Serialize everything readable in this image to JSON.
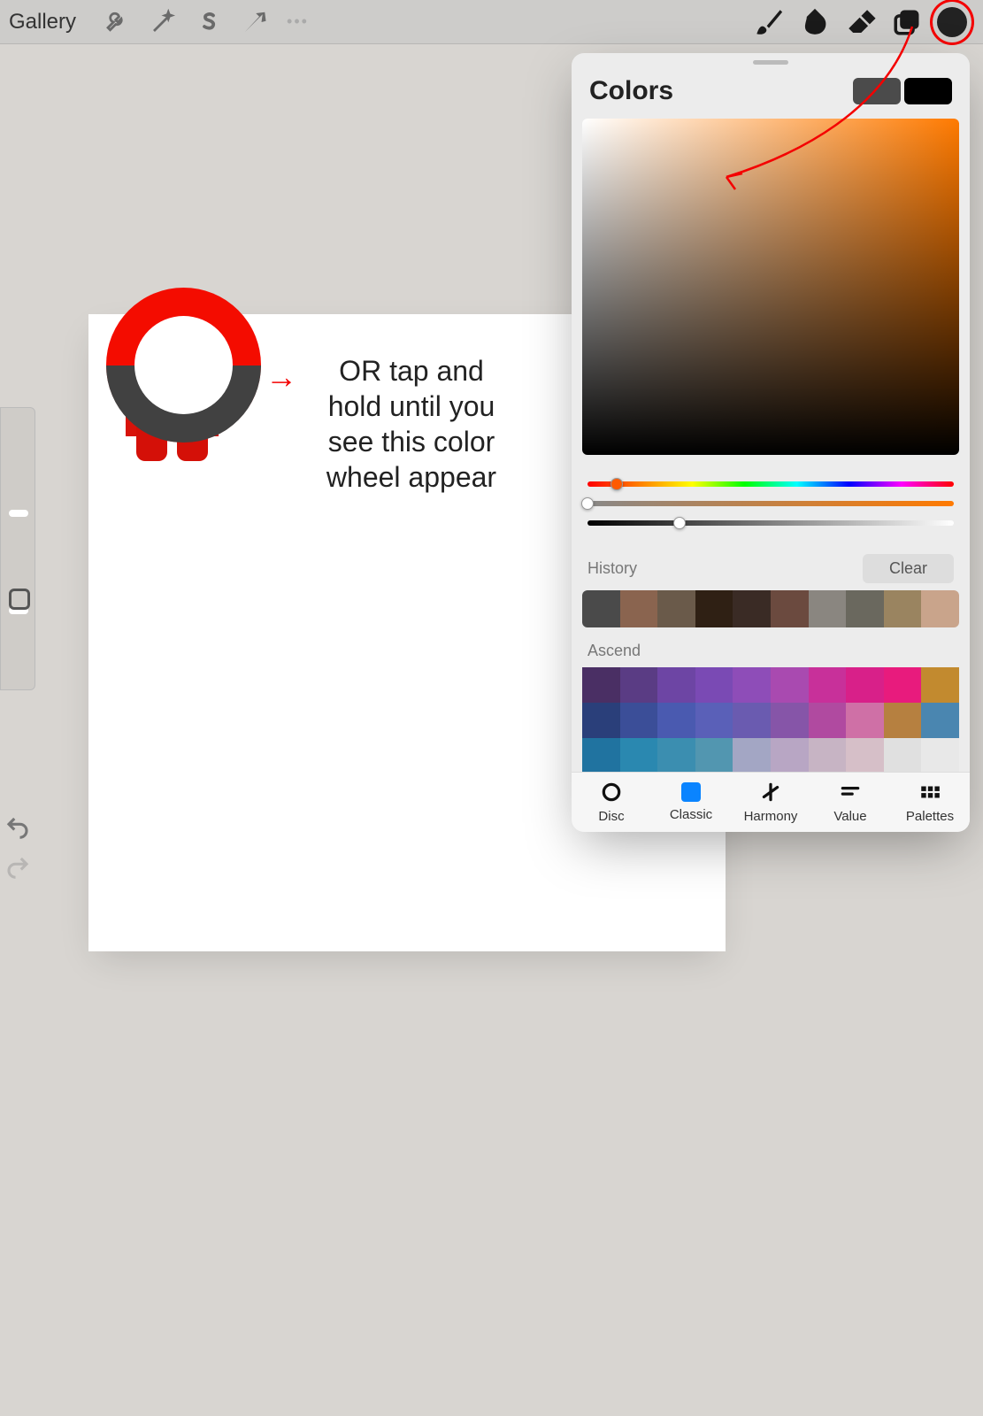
{
  "toolbar": {
    "gallery_label": "Gallery",
    "icons": {
      "wrench": "settings-wrench",
      "wand": "adjustments-wand",
      "selection": "selection-s",
      "transform": "transform-arrow",
      "brush": "brush",
      "smudge": "smudge",
      "erase": "eraser",
      "layers": "layers",
      "color": "#222222"
    }
  },
  "annotation": {
    "instructions": "OR tap and hold until you see this color wheel appear"
  },
  "colors_panel": {
    "title": "Colors",
    "prev_color": "#4b4b4b",
    "curr_color": "#000000",
    "hue_deg": 28,
    "hue_slider_pos": 0.08,
    "sat_slider_pos": 0.0,
    "val_slider_pos": 0.25,
    "history_label": "History",
    "clear_label": "Clear",
    "history": [
      "#4a4a4a",
      "#8a644f",
      "#6a5a4a",
      "#2f2014",
      "#3a2b25",
      "#6b4a3f",
      "#8a8680",
      "#6a685e",
      "#9a8460",
      "#c9a48b"
    ],
    "palette_label": "Ascend",
    "palette_rows": [
      [
        "#4a2f64",
        "#5a3c84",
        "#6d45a4",
        "#7a4ab4",
        "#8e4db8",
        "#a94ab0",
        "#c8309a",
        "#d82089",
        "#e81b7d",
        "#c28a2f"
      ],
      [
        "#2a3f7a",
        "#3b4e98",
        "#4a5ab0",
        "#5a60b8",
        "#6a5bb0",
        "#8655a8",
        "#b04aa0",
        "#cf70a6",
        "#b68040",
        "#4a86b0"
      ],
      [
        "#2073a0",
        "#2a88b0",
        "#3b8eb0",
        "#5296b0",
        "#a3a6c4",
        "#b8a6c4",
        "#c7b4c4",
        "#d6bfc8",
        "#e0e0e0",
        "#e8e8e8"
      ]
    ],
    "tabs": [
      {
        "key": "disc",
        "label": "Disc"
      },
      {
        "key": "classic",
        "label": "Classic"
      },
      {
        "key": "harmony",
        "label": "Harmony"
      },
      {
        "key": "value",
        "label": "Value"
      },
      {
        "key": "palettes",
        "label": "Palettes"
      }
    ],
    "active_tab": "classic"
  }
}
